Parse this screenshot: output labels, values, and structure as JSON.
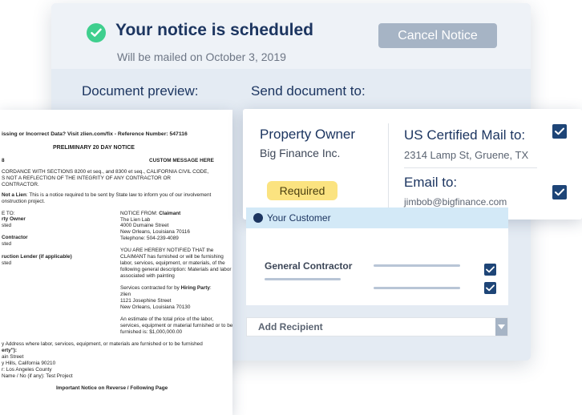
{
  "header": {
    "title": "Your notice is scheduled",
    "subtitle": "Will be mailed on October 3, 2019",
    "cancel_label": "Cancel Notice"
  },
  "sections": {
    "preview_label": "Document preview:",
    "send_label": "Send document to:"
  },
  "document": {
    "line1": "issing or Incorrect Data? Visit zlien.com/fix - Reference Number: 547116",
    "title": "PRELIMINARY 20 DAY NOTICE",
    "left_code": "8",
    "custom": "CUSTOM MESSAGE HERE",
    "p1": [
      "CORDANCE WITH SECTIONS 8200 et seq., and 8300 et seq., CALIFORNIA CIVIL CODE,",
      "S NOT A REFLECTION OF THE INTEGRITY OF ANY CONTRACTOR OR",
      "CONTRACTOR."
    ],
    "lien_label": "Not a Lien",
    "lien_text": ": This is a notice required to be sent by State law to inform you of our involvement",
    "lien_text2": "onstruction project.",
    "to_label": "E TO:",
    "owner_label": "rty Owner",
    "listed1": "sted",
    "contractor_label": "Contractor",
    "listed2": "sted",
    "lender_label": "ruction Lender (if applicable)",
    "listed3": "sted",
    "from_label": "NOTICE FROM:",
    "from_name": "Claimant",
    "from_lines": [
      "The Lien Lab",
      "4000 Dumaine Street",
      "New Orleans, Louisiana 70116",
      "Telephone:  504-239-4089"
    ],
    "notified": [
      "YOU ARE HEREBY NOTIFIED THAT the",
      "CLAIMANT has furnished or will be furnishing",
      "labor, services, equipment, or materials, of the",
      "following general description: Materials and labor",
      "associated with painting"
    ],
    "services_pre": "Services contracted for by ",
    "services_party": "Hiring Party",
    "services_post": ":",
    "party_lines": [
      "zlien",
      "1121 Josephine Street",
      "New Orleans, Louisiana 70130"
    ],
    "estimate": [
      "An estimate of the total price of the labor,",
      "services, equipment or material furnished or to be",
      "furnished is: $1,000,000.00"
    ],
    "address_line": "y Address where labor, services, equipment, or materials are furnished or to be furnished",
    "property_label": "erty\"):",
    "prop_lines": [
      "ain Street",
      "y Hills, California 90210",
      "r:  Los Angeles County",
      "Name / No (if any): Test Project"
    ],
    "footer": "Important Notice on Reverse / Following Page"
  },
  "recipient": {
    "role": "Property Owner",
    "name": "Big Finance Inc.",
    "badge": "Required",
    "mail_label": "US Certified Mail to:",
    "mail_address": "2314 Lamp St, Gruene, TX",
    "email_label": "Email to:",
    "email_address": "jimbob@bigfinance.com"
  },
  "customer": {
    "header": "Your Customer",
    "role": "General Contractor"
  },
  "add_recipient": "Add Recipient",
  "colors": {
    "navy": "#1c3560",
    "checkbox": "#1e4577",
    "success": "#3fcf8e",
    "badge": "#fbe380"
  }
}
